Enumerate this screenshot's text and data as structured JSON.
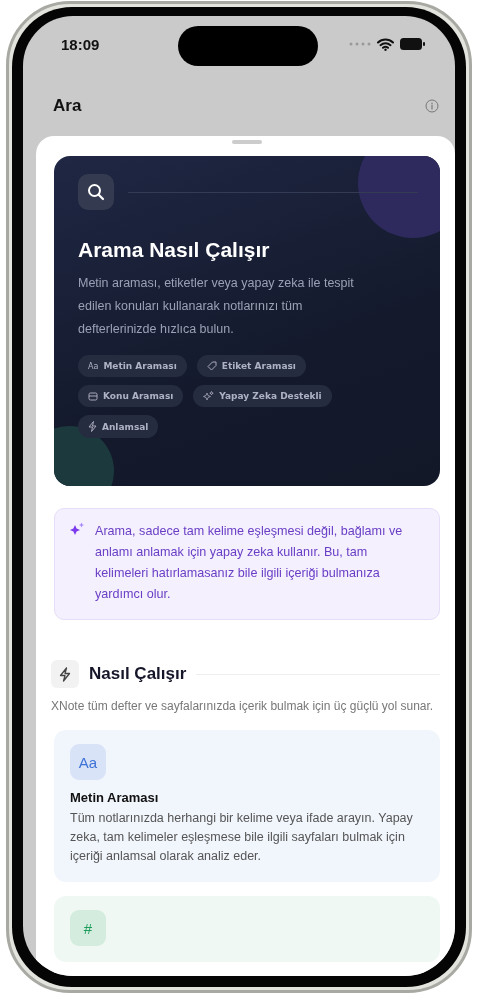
{
  "status_bar": {
    "time": "18:09"
  },
  "nav": {
    "title": "Ara"
  },
  "hero": {
    "title": "Arama Nasıl Çalışır",
    "description": "Metin araması, etiketler veya yapay zeka ile tespit edilen konuları kullanarak notlarınızı tüm defterlerinizde hızlıca bulun.",
    "chips": [
      {
        "kind": "text",
        "glyph": "Aa",
        "label": "Metin Araması"
      },
      {
        "kind": "tag",
        "label": "Etiket Araması"
      },
      {
        "kind": "box",
        "label": "Konu Araması"
      },
      {
        "kind": "sparkles",
        "label": "Yapay Zeka Destekli"
      },
      {
        "kind": "bolt",
        "label": "Anlamsal"
      }
    ]
  },
  "notice": {
    "text": "Arama, sadece tam kelime eşleşmesi değil, bağlamı ve anlamı anlamak için yapay zeka kullanır. Bu, tam kelimeleri hatırlamasanız bile ilgili içeriği bulmanıza yardımcı olur."
  },
  "section": {
    "title": "Nasıl Çalışır",
    "description": "XNote tüm defter ve sayfalarınızda içerik bulmak için üç güçlü yol sunar."
  },
  "cards": [
    {
      "glyph": "Aa",
      "color": "#3f72d6",
      "title": "Metin Araması",
      "description": "Tüm notlarınızda herhangi bir kelime veya ifade arayın. Yapay zeka, tam kelimeler eşleşmese bile ilgili sayfaları bulmak için içeriği anlamsal olarak analiz eder."
    },
    {
      "glyph": "#",
      "color": "#1e9e5c"
    }
  ]
}
